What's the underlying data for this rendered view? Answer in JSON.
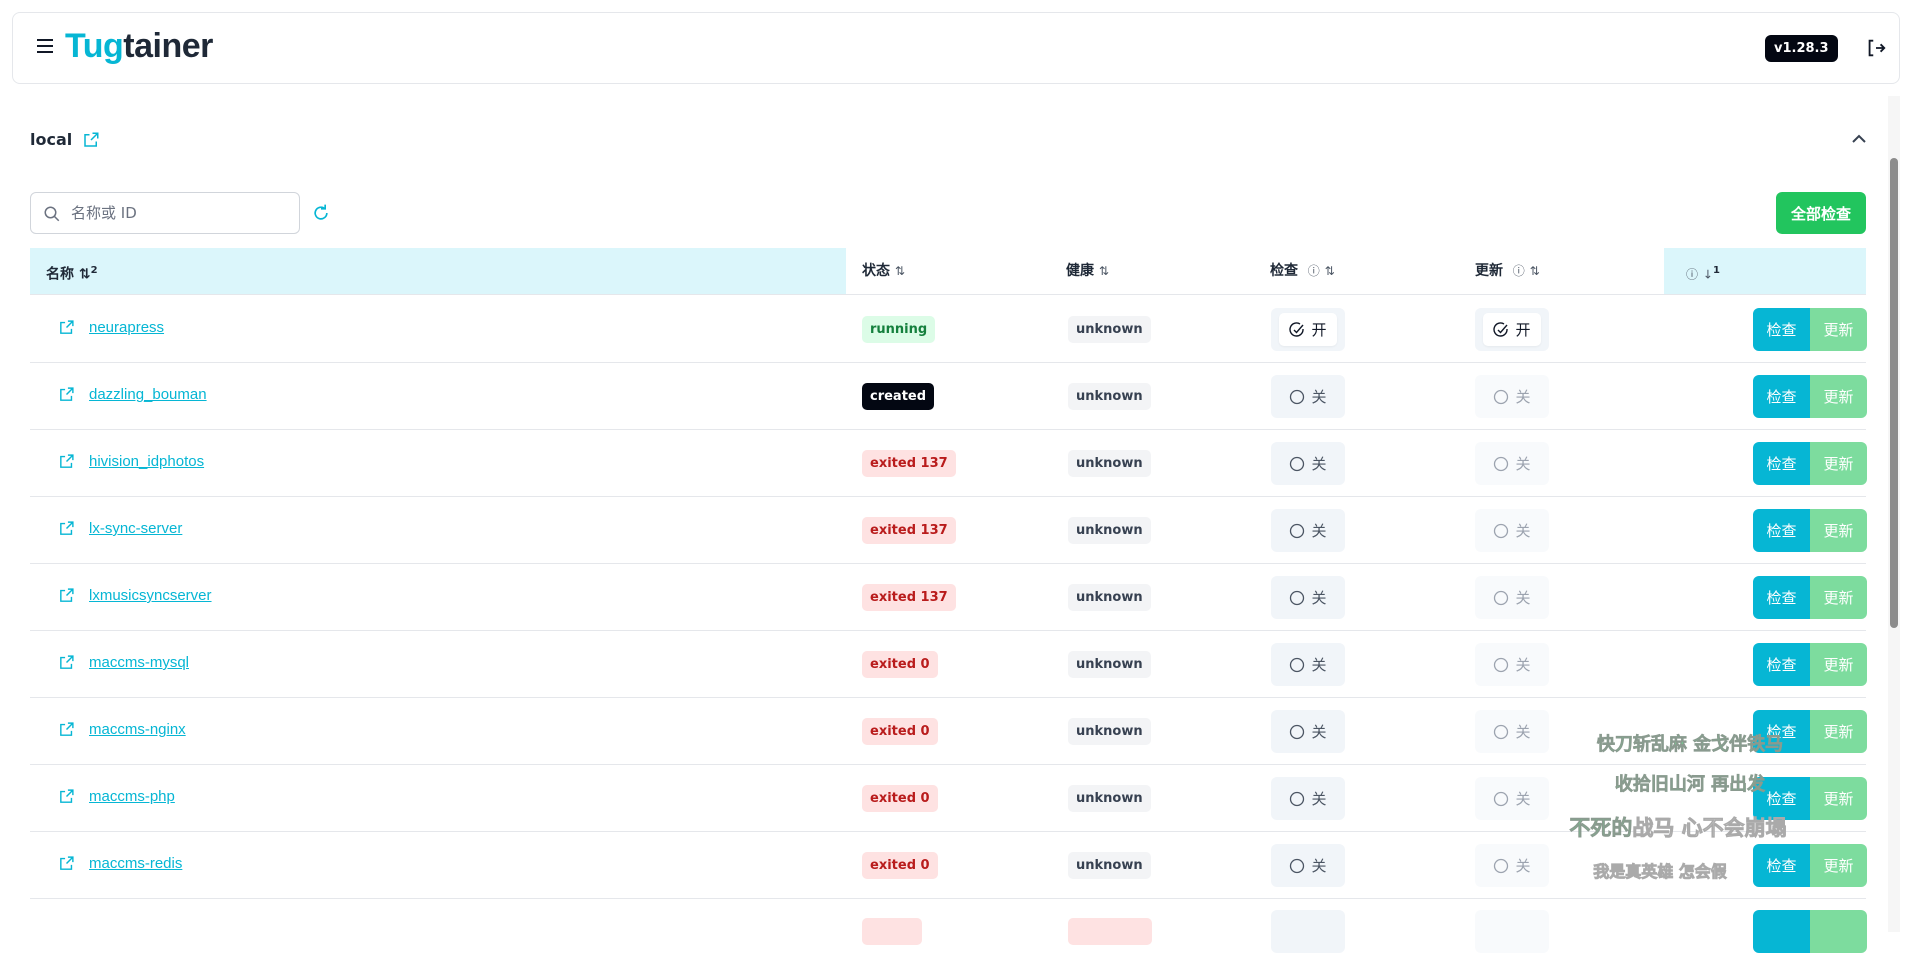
{
  "header": {
    "title_accent": "Tug",
    "title_rest": "tainer",
    "version": "v1.28.3"
  },
  "host": {
    "name": "local"
  },
  "toolbar": {
    "search_placeholder": "名称或 ID",
    "check_all_label": "全部检查"
  },
  "table": {
    "columns": {
      "name": "名称",
      "name_sort_index": "2",
      "status": "状态",
      "health": "健康",
      "check": "检查",
      "update": "更新",
      "actions_sort_index": "1"
    },
    "rows": [
      {
        "name": "neurapress",
        "status": "running",
        "status_type": "running",
        "health": "unknown",
        "check": "开",
        "check_on": true,
        "update": "开",
        "update_on": true
      },
      {
        "name": "dazzling_bouman",
        "status": "created",
        "status_type": "created",
        "health": "unknown",
        "check": "关",
        "check_on": false,
        "update": "关",
        "update_on": false
      },
      {
        "name": "hivision_idphotos",
        "status": "exited 137",
        "status_type": "exited",
        "health": "unknown",
        "check": "关",
        "check_on": false,
        "update": "关",
        "update_on": false
      },
      {
        "name": "lx-sync-server",
        "status": "exited 137",
        "status_type": "exited",
        "health": "unknown",
        "check": "关",
        "check_on": false,
        "update": "关",
        "update_on": false
      },
      {
        "name": "lxmusicsyncserver",
        "status": "exited 137",
        "status_type": "exited",
        "health": "unknown",
        "check": "关",
        "check_on": false,
        "update": "关",
        "update_on": false
      },
      {
        "name": "maccms-mysql",
        "status": "exited 0",
        "status_type": "exited",
        "health": "unknown",
        "check": "关",
        "check_on": false,
        "update": "关",
        "update_on": false
      },
      {
        "name": "maccms-nginx",
        "status": "exited 0",
        "status_type": "exited",
        "health": "unknown",
        "check": "关",
        "check_on": false,
        "update": "关",
        "update_on": false
      },
      {
        "name": "maccms-php",
        "status": "exited 0",
        "status_type": "exited",
        "health": "unknown",
        "check": "关",
        "check_on": false,
        "update": "关",
        "update_on": false
      },
      {
        "name": "maccms-redis",
        "status": "exited 0",
        "status_type": "exited",
        "health": "unknown",
        "check": "关",
        "check_on": false,
        "update": "关",
        "update_on": false
      }
    ],
    "row_actions": {
      "check": "检查",
      "update": "更新"
    }
  },
  "lyrics": {
    "line1": "快刀斩乱麻  金戈伴铁马",
    "line2": "收拾旧山河  再出发",
    "line3_sung": "不死的",
    "line3_rest": "战马  心不会崩塌",
    "line4": "我是真英雄  怎会假"
  },
  "colors": {
    "accent": "#06b6d4",
    "success": "#22c55e",
    "update_btn": "#7ddc9e"
  }
}
